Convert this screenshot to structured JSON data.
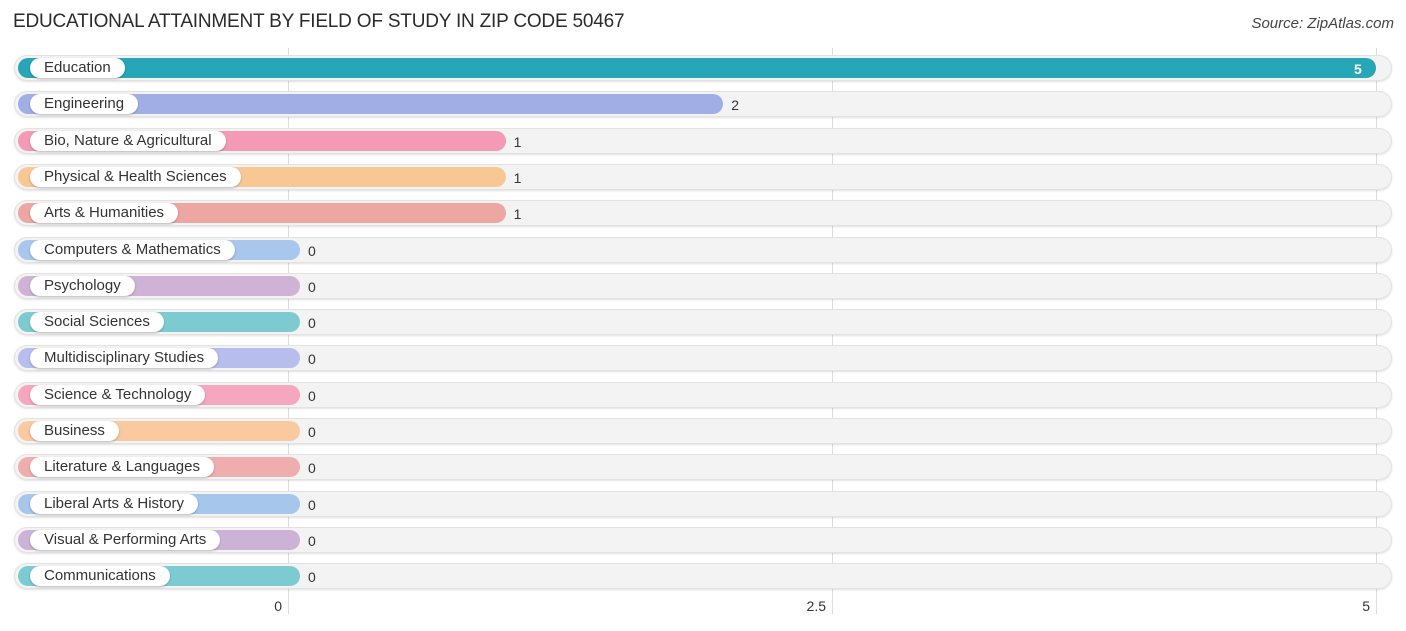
{
  "header": {
    "title": "EDUCATIONAL ATTAINMENT BY FIELD OF STUDY IN ZIP CODE 50467",
    "source": "Source: ZipAtlas.com"
  },
  "chart_data": {
    "type": "bar",
    "orientation": "horizontal",
    "title": "EDUCATIONAL ATTAINMENT BY FIELD OF STUDY IN ZIP CODE 50467",
    "xlabel": "",
    "ylabel": "",
    "xlim": [
      0,
      5
    ],
    "x_ticks": [
      "0",
      "2.5",
      "5"
    ],
    "x_tick_values": [
      0,
      2.5,
      5
    ],
    "grid": true,
    "categories": [
      "Education",
      "Engineering",
      "Bio, Nature & Agricultural",
      "Physical & Health Sciences",
      "Arts & Humanities",
      "Computers & Mathematics",
      "Psychology",
      "Social Sciences",
      "Multidisciplinary Studies",
      "Science & Technology",
      "Business",
      "Literature & Languages",
      "Liberal Arts & History",
      "Visual & Performing Arts",
      "Communications"
    ],
    "values": [
      5,
      2,
      1,
      1,
      1,
      0,
      0,
      0,
      0,
      0,
      0,
      0,
      0,
      0,
      0
    ],
    "colors": [
      "#26a6b6",
      "#a1aee6",
      "#f59ab6",
      "#f8c894",
      "#eca7a3",
      "#a9c6ec",
      "#cfb2d6",
      "#7dcbd1",
      "#b7bdec",
      "#f6a7c0",
      "#f9caa0",
      "#efaeae",
      "#a7c6ec",
      "#cdb2d8",
      "#7ccbd3"
    ]
  }
}
